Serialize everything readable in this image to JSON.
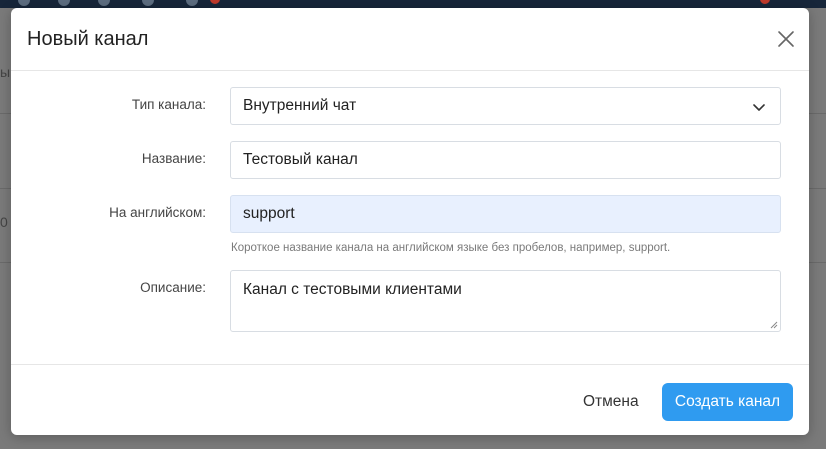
{
  "modal": {
    "title": "Новый канал",
    "close_icon": "close-icon"
  },
  "form": {
    "channel_type": {
      "label": "Тип канала:",
      "selected": "Внутренний чат",
      "icon": "chevron-down-icon"
    },
    "name": {
      "label": "Название:",
      "value": "Тестовый канал"
    },
    "english": {
      "label": "На английском:",
      "value": "support",
      "help": "Короткое название канала на английском языке без пробелов, например, support."
    },
    "description": {
      "label": "Описание:",
      "value": "Канал с тестовыми клиентами"
    }
  },
  "footer": {
    "cancel_label": "Отмена",
    "submit_label": "Создать канал"
  },
  "background": {
    "left_text_1": "ы",
    "left_text_2": "0"
  },
  "colors": {
    "primary": "#2f9bf0",
    "autofill": "#e8f0fe",
    "topbar": "#17263a",
    "badge": "#c0392b"
  }
}
